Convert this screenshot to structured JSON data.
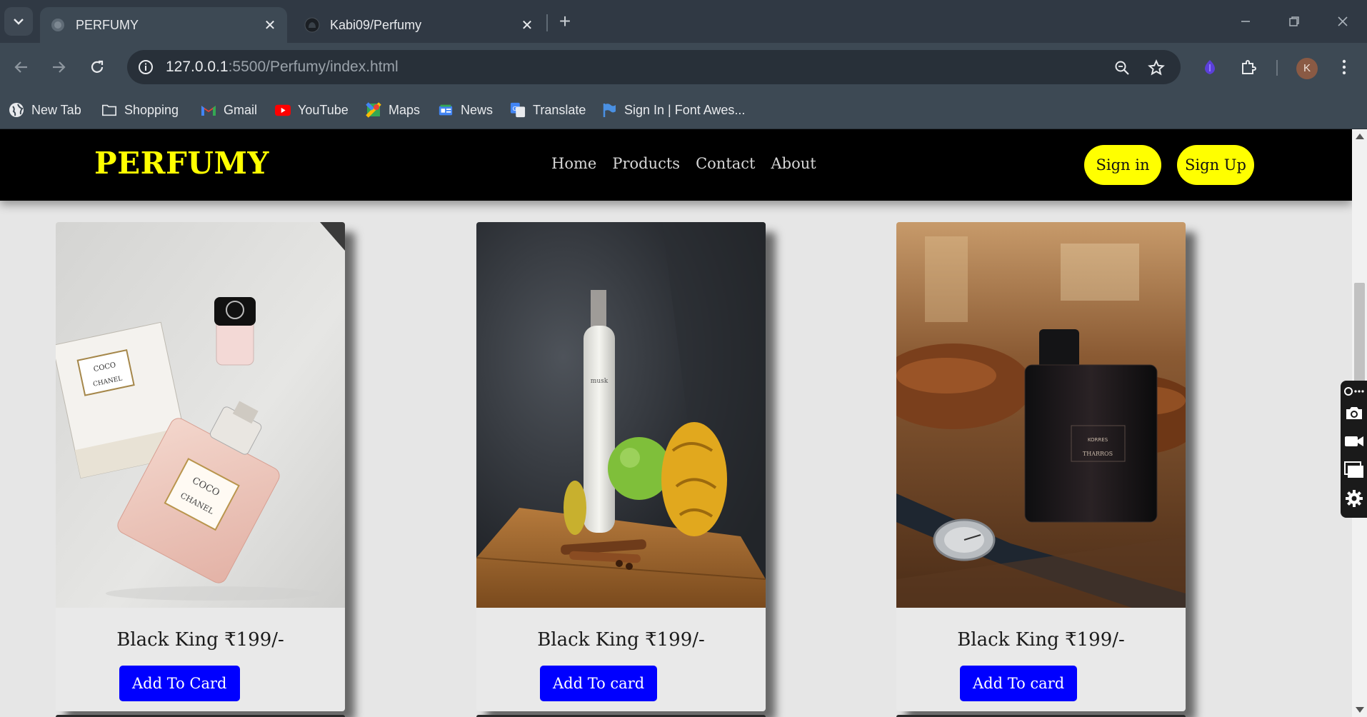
{
  "browser": {
    "tabs": [
      {
        "title": "PERFUMY",
        "active": true
      },
      {
        "title": "Kabi09/Perfumy",
        "active": false
      }
    ],
    "url_host": "127.0.0.1",
    "url_path": ":5500/Perfumy/index.html",
    "profile_initial": "K",
    "bookmarks": [
      {
        "label": "New Tab",
        "icon": "globe-icon"
      },
      {
        "label": "Shopping",
        "icon": "folder-icon"
      },
      {
        "label": "Gmail",
        "icon": "gmail-icon"
      },
      {
        "label": "YouTube",
        "icon": "youtube-icon"
      },
      {
        "label": "Maps",
        "icon": "maps-icon"
      },
      {
        "label": "News",
        "icon": "news-icon"
      },
      {
        "label": "Translate",
        "icon": "translate-icon"
      },
      {
        "label": "Sign In | Font Awes...",
        "icon": "flag-icon"
      }
    ]
  },
  "site": {
    "logo": "PERFUMY",
    "nav": [
      "Home",
      "Products",
      "Contact",
      "About"
    ],
    "sign_in": "Sign in",
    "sign_up": "Sign Up",
    "colors": {
      "accent": "#ffff00",
      "header_bg": "#000000",
      "button_blue": "#0000ff"
    }
  },
  "products": [
    {
      "name": "Black King ₹199/-",
      "button": "Add To Card",
      "image": "chanel-coco-perfume-photo"
    },
    {
      "name": "Black King ₹199/-",
      "button": "Add To card",
      "image": "white-bottle-with-fruits-photo"
    },
    {
      "name": "Black King ₹199/-",
      "button": "Add To card",
      "image": "korres-tharros-bottle-with-watch-photo"
    }
  ]
}
